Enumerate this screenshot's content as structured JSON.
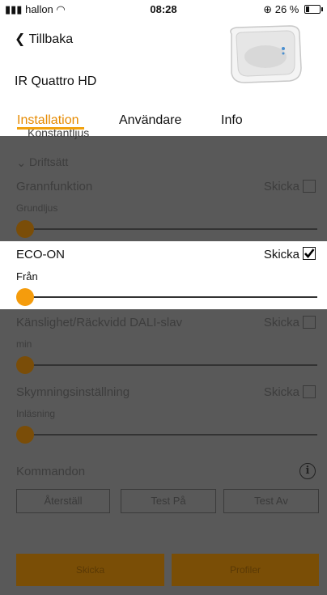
{
  "status_bar": {
    "carrier": "hallon",
    "time": "08:28",
    "battery": "26 %"
  },
  "header": {
    "back_label": "Tillbaka",
    "device_name": "IR Quattro HD"
  },
  "tabs": [
    {
      "label": "Installation",
      "active": true
    },
    {
      "label": "Användare",
      "active": false
    },
    {
      "label": "Info",
      "active": false
    }
  ],
  "sections": {
    "partial_above": "Konstantljus",
    "driftsatt": "Driftsätt"
  },
  "settings": [
    {
      "label": "Grannfunktion",
      "sub": "Grundljus",
      "send_label": "Skicka",
      "checked": false,
      "slider": 0
    },
    {
      "label": "ECO-ON",
      "sub": "Från",
      "send_label": "Skicka",
      "checked": true,
      "slider": 0
    },
    {
      "label": "Känslighet/Räckvidd DALI-slav",
      "sub": "min",
      "send_label": "Skicka",
      "checked": false,
      "slider": 0
    },
    {
      "label": "Skymningsinställning",
      "sub": "Inläsning",
      "send_label": "Skicka",
      "checked": false,
      "slider": 0
    }
  ],
  "commands": {
    "title": "Kommandon",
    "buttons": [
      "Återställ",
      "Test På",
      "Test Av"
    ]
  },
  "footer": {
    "send": "Skicka",
    "profiles": "Profiler"
  },
  "colors": {
    "accent": "#f59c0c",
    "overlay": "#595959"
  }
}
